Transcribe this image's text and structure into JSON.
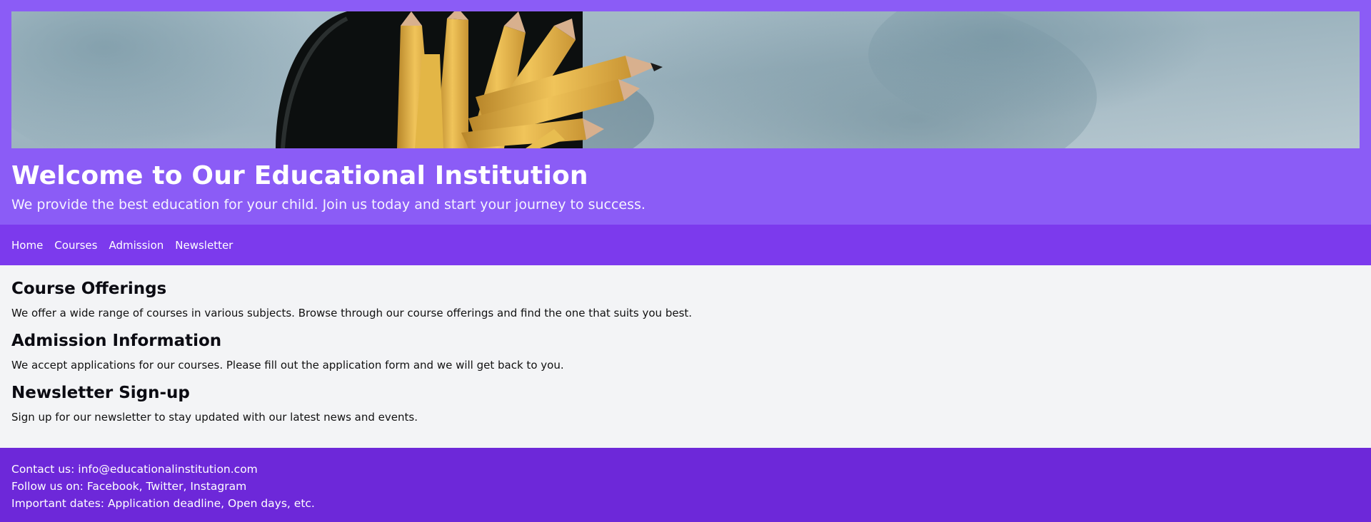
{
  "colors": {
    "hero_bg": "#8b5cf6",
    "nav_bg": "#7c3aed",
    "main_bg": "#f3f4f6",
    "footer_bg": "#6d28d9",
    "text_light": "#ffffff"
  },
  "hero": {
    "banner_image": "pencils-in-cup-photo",
    "title": "Welcome to Our Educational Institution",
    "subtitle": "We provide the best education for your child. Join us today and start your journey to success."
  },
  "nav": {
    "items": [
      {
        "label": "Home"
      },
      {
        "label": "Courses"
      },
      {
        "label": "Admission"
      },
      {
        "label": "Newsletter"
      }
    ]
  },
  "sections": [
    {
      "heading": "Course Offerings",
      "body": "We offer a wide range of courses in various subjects. Browse through our course offerings and find the one that suits you best."
    },
    {
      "heading": "Admission Information",
      "body": "We accept applications for our courses. Please fill out the application form and we will get back to you."
    },
    {
      "heading": "Newsletter Sign-up",
      "body": "Sign up for our newsletter to stay updated with our latest news and events."
    }
  ],
  "footer": {
    "contact": "Contact us: info@educationalinstitution.com",
    "follow": "Follow us on: Facebook, Twitter, Instagram",
    "dates": "Important dates: Application deadline, Open days, etc."
  }
}
